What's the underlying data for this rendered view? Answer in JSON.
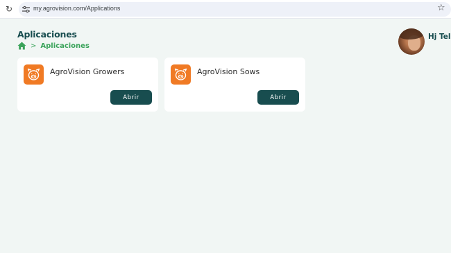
{
  "browser": {
    "url": "my.agrovision.com/Applications",
    "reload_icon": "reload-icon",
    "site_info_icon": "tune-icon",
    "bookmark_icon": "star-icon"
  },
  "header": {
    "title": "Aplicaciones",
    "breadcrumb": {
      "home_icon": "home-icon",
      "separator": ">",
      "current": "Aplicaciones"
    }
  },
  "user": {
    "name": "Hj Telle"
  },
  "apps": [
    {
      "name": "AgroVision Growers",
      "icon": "pig-icon",
      "button_label": "Abrir"
    },
    {
      "name": "AgroVision Sows",
      "icon": "pig-icon",
      "button_label": "Abrir"
    }
  ],
  "colors": {
    "brand_dark": "#184d4f",
    "accent_green": "#3aa35a",
    "app_icon_orange": "#f07a24",
    "page_background": "#f1f6f4"
  }
}
